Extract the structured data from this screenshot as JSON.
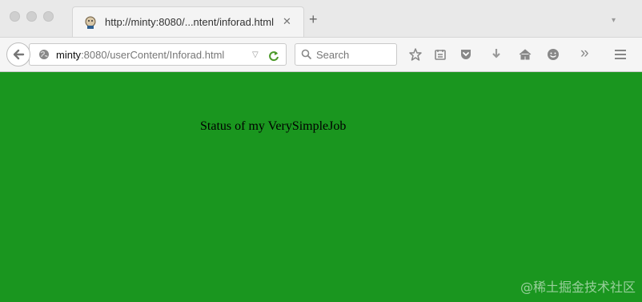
{
  "browser": {
    "tab": {
      "title": "http://minty:8080/...ntent/inforad.html",
      "close_glyph": "✕",
      "favicon": "jenkins-favicon-icon"
    },
    "new_tab_glyph": "+",
    "tab_list_glyph": "▾",
    "address_bar": {
      "host": "minty",
      "rest": ":8080/userContent/Inforad.html",
      "dropdown_glyph": "▽",
      "reload_glyph": "C"
    },
    "search": {
      "placeholder": "Search"
    },
    "toolbar_icons": [
      "star-icon",
      "reading-list-icon",
      "pocket-icon",
      "download-icon",
      "home-icon",
      "emoji-icon",
      "overflow-chevrons-icon",
      "hamburger-menu-icon"
    ],
    "overflow_glyph": "»"
  },
  "page": {
    "background_color": "#1a961f",
    "heading": "Status of my VerySimpleJob"
  },
  "watermark": "@稀土掘金技术社区"
}
